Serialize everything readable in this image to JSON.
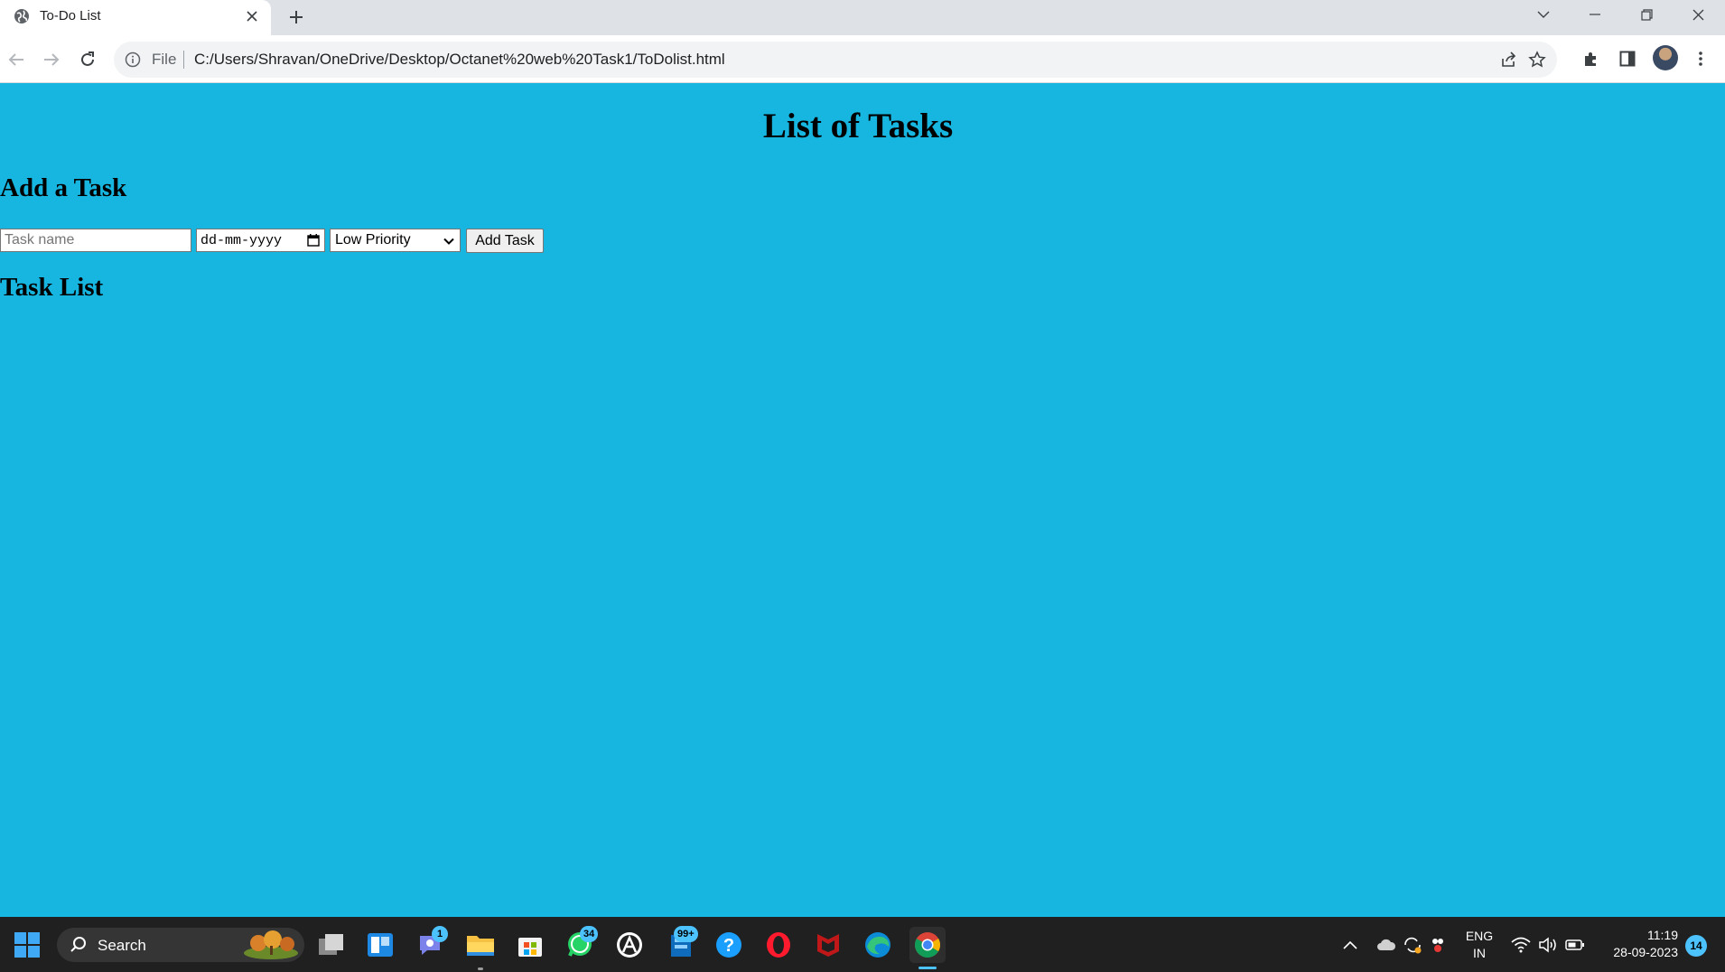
{
  "browser": {
    "tab_title": "To-Do List",
    "url_scheme_label": "File",
    "url": "C:/Users/Shravan/OneDrive/Desktop/Octanet%20web%20Task1/ToDolist.html"
  },
  "page": {
    "title": "List of Tasks",
    "add_section_heading": "Add a Task",
    "task_name_placeholder": "Task name",
    "date_placeholder": "dd-mm-yyyy",
    "priority_selected": "Low Priority",
    "add_button_label": "Add Task",
    "list_section_heading": "Task List",
    "background_color": "#16b6e0"
  },
  "taskbar": {
    "search_label": "Search",
    "teams_badge": "1",
    "whatsapp_badge": "34",
    "app_badge": "99+",
    "language_line1": "ENG",
    "language_line2": "IN",
    "time": "11:19",
    "date": "28-09-2023",
    "notification_count": "14"
  }
}
